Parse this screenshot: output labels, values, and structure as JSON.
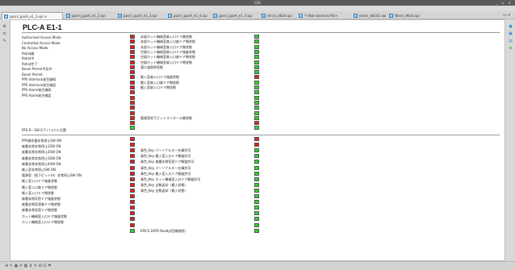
{
  "window": {
    "title": "CSS",
    "controls": "_ ▫ ✕"
  },
  "tabs": [
    {
      "label": "ppsni_ppsA_e1_1.opi ✕",
      "active": true
    },
    {
      "label": "ppsni_ppsA_e1_2.opi",
      "active": false
    },
    {
      "label": "ppsni_ppsA_e1_3.opi",
      "active": false
    },
    {
      "label": "ppsni_ppsA_e1_4.opi",
      "active": false
    },
    {
      "label": "ppsni_ppsA_e1_5.opi",
      "active": false
    },
    {
      "label": "ntnsn_db10.opi",
      "active": false
    },
    {
      "label": "*<Not saved to file>",
      "active": false
    },
    {
      "label": "ntnsn_db101.opi",
      "active": false
    },
    {
      "label": "Ntnsn_Main.opi",
      "active": false
    }
  ],
  "tab_overflow": "»₉ ▾",
  "page": {
    "title": "PLC-A E1-1"
  },
  "upper_left_labels": [
    "Authorized Access Mode",
    "Controlled Access Mode",
    "No Access Mode",
    "Patrol開",
    "Patrol中",
    "Patrol完了",
    "Beam Permit予告中",
    "Beam Permit",
    "PPS Interlock発生継続",
    "PPS Interlock発生確認",
    "PPS Alarm発生継続",
    "PPS Alarm発生確認"
  ],
  "upper_bottom_label": "PPS  R－SW  O F / r a t e 位置",
  "upper_led_col1": [
    "red",
    "red",
    "red",
    "red",
    "red",
    "red",
    "red",
    "red",
    "red",
    "red",
    "red",
    "red",
    "red",
    "red",
    "red",
    "red",
    "red",
    "red",
    "green"
  ],
  "upper_descs": [
    "本部ホット機械室扉入口ドア開状態",
    "本部ホット機械室扉入口扉ドア閉状態",
    "本部ホット機械室扉入口ドア閉状態",
    "空調ホット機械室扉入口ドア施錠状態",
    "空調ホット機械室扉入口扉ドア閉状態",
    "空調ホット機械室扉入口ドア閉状態",
    "通り道照明状態",
    "",
    "搬入室扉入口ドア施錠状態",
    "搬入室扉入口扉ドア閉状態",
    "搬入室扉入口ドア閉状態",
    "",
    "",
    "",
    "",
    "",
    "電源室地下ピットマンホール開状態",
    "",
    ""
  ],
  "upper_led_col2": [
    "green",
    "green",
    "green",
    "green",
    "green",
    "green",
    "green",
    "green",
    "red",
    "green",
    "green",
    "green",
    "green",
    "green",
    "green",
    "green",
    "green",
    "red",
    "green"
  ],
  "lower_left_labels": [
    "PPS操作盤非常停止SW  ON",
    "扉番非常非常停止1SW  ON",
    "扉番非常非常停止2SW  ON",
    "扉番非常非常停止3SW  ON",
    "扉番非常非常停止4SW  ON",
    "搬入室非常停止SW  ON",
    "電源室（地下ピット内）非常停止SW  ON",
    "搬入室入口ドア施錠状態",
    "搬入室入口扉ドア閉状態",
    "搬入室入口ドア閉状態",
    "扉番非常気密ドア施錠状態",
    "扉番非常気密扉ドア閉状態",
    "扉番非常気密ドア閉状態",
    "ホット機械室入口ドア施錠状態",
    "ホット機械室入口ドア閉状態"
  ],
  "lower_led_col1": [
    "red",
    "red",
    "red",
    "red",
    "red",
    "red",
    "red",
    "red",
    "red",
    "red",
    "red",
    "red",
    "red",
    "red",
    "red",
    "red",
    "green"
  ],
  "lower_descs": [
    "",
    "",
    "青色_Key  パーソナルキー在庫許可",
    "青色_Key  搬入室入口ドア解錠許可",
    "青色_Key  扉番非常気密ドア解錠許可",
    "青色_Key  パーソナルキー在庫許可",
    "青色_Key  搬入室入口ドア解錠許可",
    "青色_Key  ホット機械室入口ドア解錠許可",
    "青色_Key  全数返却（搬入状態）",
    "青色_Key  全数返却（搬入状態）",
    "",
    "",
    "",
    "",
    "",
    "",
    "EPICS DATA Ready(回線接続)"
  ],
  "lower_led_col2": [
    "red",
    "red",
    "green",
    "green",
    "green",
    "green",
    "green",
    "green",
    "green",
    "green",
    "green",
    "green",
    "green",
    "green",
    "green",
    "green",
    "green"
  ],
  "left_toolbar_icons": [
    "⊕",
    "⇆",
    "✎"
  ],
  "right_toolbar_icons": [
    "●",
    "▣",
    "▤",
    "⚙"
  ],
  "status_icons": "⊕ ✎ ▣ ⟳ ▦ ⬇ ✕ ⊞ ⊡ ⚑"
}
